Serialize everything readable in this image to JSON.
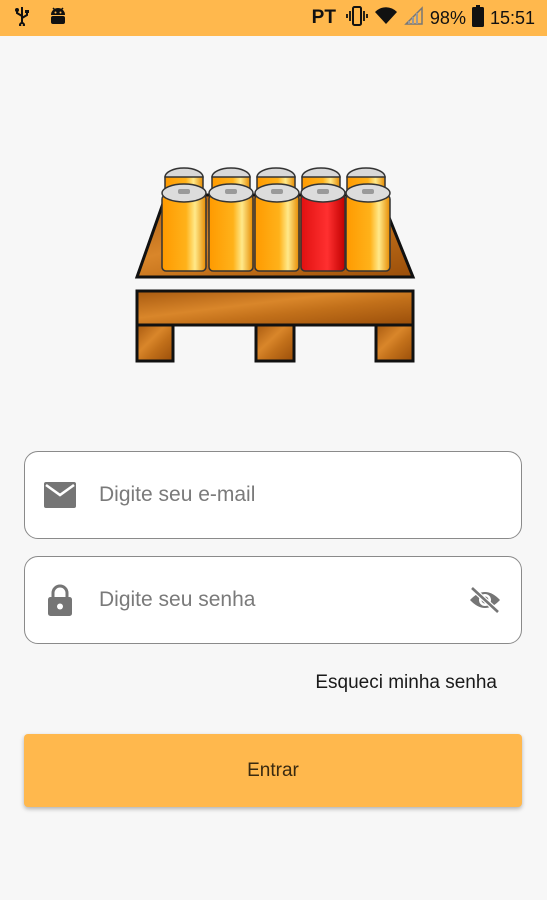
{
  "status_bar": {
    "carrier": "PT",
    "battery": "98%",
    "time": "15:51",
    "icons": [
      "usb-icon",
      "android-debug-icon",
      "vibrate-icon",
      "wifi-icon",
      "signal-icon",
      "battery-icon"
    ]
  },
  "login": {
    "email_placeholder": "Digite seu e-mail",
    "password_placeholder": "Digite seu senha",
    "forgot_label": "Esqueci minha senha",
    "submit_label": "Entrar"
  },
  "colors": {
    "accent": "#ffb84d",
    "background": "#f7f7f7",
    "field_border": "#8a8a8a",
    "icon_gray": "#757575",
    "can_orange": "#ffa500",
    "can_red": "#ee2222",
    "pallet_brown": "#c8721a"
  }
}
